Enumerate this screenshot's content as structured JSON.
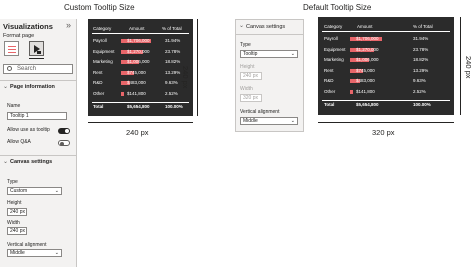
{
  "captions": {
    "custom": "Custom Tooltip Size",
    "default": "Default Tooltip Size"
  },
  "dimensions": {
    "custom_height": "240 px",
    "custom_width": "240 px",
    "default_height": "240 px",
    "default_width": "320 px"
  },
  "viz_pane": {
    "title": "Visualizations",
    "expand_glyph": "»",
    "format_page_label": "Format page",
    "search_placeholder": "Search",
    "page_info_header": "Page information",
    "name_label": "Name",
    "name_value": "Tooltip 1",
    "allow_tooltip_label": "Allow use as tooltip",
    "allow_tooltip_state": "On",
    "allow_qa_label": "Allow Q&A",
    "allow_qa_state": "Off",
    "canvas_header": "Canvas settings",
    "type_label": "Type",
    "type_value": "Custom",
    "height_label": "Height",
    "height_value": "240 px",
    "width_label": "Width",
    "width_value": "240 px",
    "valign_label": "Vertical alignment",
    "valign_value": "Middle"
  },
  "mid_panel": {
    "canvas_header": "Canvas settings",
    "type_label": "Type",
    "type_value": "Tooltip",
    "height_label": "Height",
    "height_value": "240 px",
    "width_label": "Width",
    "width_value": "320 px",
    "valign_label": "Vertical alignment",
    "valign_value": "Middle"
  },
  "table": {
    "headers": [
      "Category",
      "Amount",
      "% of Total"
    ],
    "rows": [
      {
        "category": "Payroll",
        "amount": "$1,706,000",
        "pct": "31.94%",
        "bar": 1.0
      },
      {
        "category": "Equipment",
        "amount": "$1,270,000",
        "pct": "23.78%",
        "bar": 0.74
      },
      {
        "category": "Marketing",
        "amount": "$1,006,000",
        "pct": "18.82%",
        "bar": 0.59
      },
      {
        "category": "Rent",
        "amount": "$745,000",
        "pct": "13.29%",
        "bar": 0.42
      },
      {
        "category": "R&D",
        "amount": "$483,000",
        "pct": "9.63%",
        "bar": 0.3
      },
      {
        "category": "Other",
        "amount": "$141,800",
        "pct": "2.52%",
        "bar": 0.09
      }
    ],
    "total": {
      "category": "Total",
      "amount": "$5,654,800",
      "pct": "100.00%"
    }
  },
  "colors": {
    "bar": "#e8666a",
    "card_bg": "#2b2b2b",
    "pane_bg": "#f3f2f1"
  }
}
